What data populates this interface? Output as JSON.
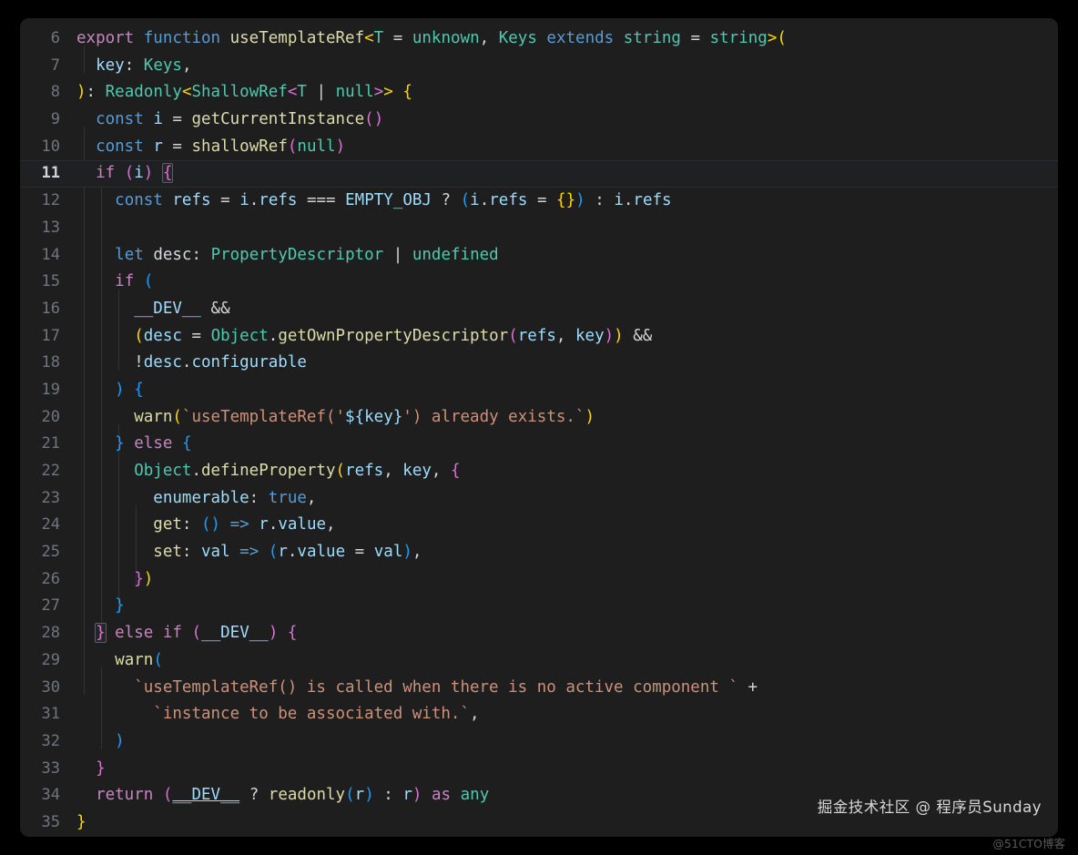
{
  "editor": {
    "language": "typescript",
    "theme": "dark-plus",
    "background_color": "#1e1e1e",
    "active_line": 11,
    "first_line_number": 6,
    "last_line_number": 35,
    "lines": [
      {
        "number": "6",
        "text": "export function useTemplateRef<T = unknown, Keys extends string = string>("
      },
      {
        "number": "7",
        "text": "  key: Keys,"
      },
      {
        "number": "8",
        "text": "): Readonly<ShallowRef<T | null>> {"
      },
      {
        "number": "9",
        "text": "  const i = getCurrentInstance()"
      },
      {
        "number": "10",
        "text": "  const r = shallowRef(null)"
      },
      {
        "number": "11",
        "text": "  if (i) {"
      },
      {
        "number": "12",
        "text": "    const refs = i.refs === EMPTY_OBJ ? (i.refs = {}) : i.refs"
      },
      {
        "number": "13",
        "text": ""
      },
      {
        "number": "14",
        "text": "    let desc: PropertyDescriptor | undefined"
      },
      {
        "number": "15",
        "text": "    if ("
      },
      {
        "number": "16",
        "text": "      __DEV__ &&"
      },
      {
        "number": "17",
        "text": "      (desc = Object.getOwnPropertyDescriptor(refs, key)) &&"
      },
      {
        "number": "18",
        "text": "      !desc.configurable"
      },
      {
        "number": "19",
        "text": "    ) {"
      },
      {
        "number": "20",
        "text": "      warn(`useTemplateRef('${key}') already exists.`)"
      },
      {
        "number": "21",
        "text": "    } else {"
      },
      {
        "number": "22",
        "text": "      Object.defineProperty(refs, key, {"
      },
      {
        "number": "23",
        "text": "        enumerable: true,"
      },
      {
        "number": "24",
        "text": "        get: () => r.value,"
      },
      {
        "number": "25",
        "text": "        set: val => (r.value = val),"
      },
      {
        "number": "26",
        "text": "      })"
      },
      {
        "number": "27",
        "text": "    }"
      },
      {
        "number": "28",
        "text": "  } else if (__DEV__) {"
      },
      {
        "number": "29",
        "text": "    warn("
      },
      {
        "number": "30",
        "text": "      `useTemplateRef() is called when there is no active component ` +"
      },
      {
        "number": "31",
        "text": "        `instance to be associated with.`,"
      },
      {
        "number": "32",
        "text": "    )"
      },
      {
        "number": "33",
        "text": "  }"
      },
      {
        "number": "34",
        "text": "  return (__DEV__ ? readonly(r) : r) as any"
      },
      {
        "number": "35",
        "text": "}"
      }
    ]
  },
  "watermarks": {
    "primary": "掘金技术社区 @ 程序员Sunday",
    "secondary": "@51CTO博客"
  },
  "colors": {
    "background": "#1e1e1e",
    "page_background": "#000000",
    "gutter_text": "#6e7681",
    "active_gutter_text": "#cdd3da",
    "keyword_pink": "#c586c0",
    "keyword_blue": "#569cd6",
    "function_yellow": "#dcdcaa",
    "type_teal": "#4ec9b0",
    "variable_blue": "#9cdcfe",
    "string_salmon": "#ce9178",
    "bracket_gold": "#ffd700",
    "bracket_pink": "#da70d6",
    "bracket_blue": "#179fff",
    "plain_text": "#d4d4d4"
  }
}
